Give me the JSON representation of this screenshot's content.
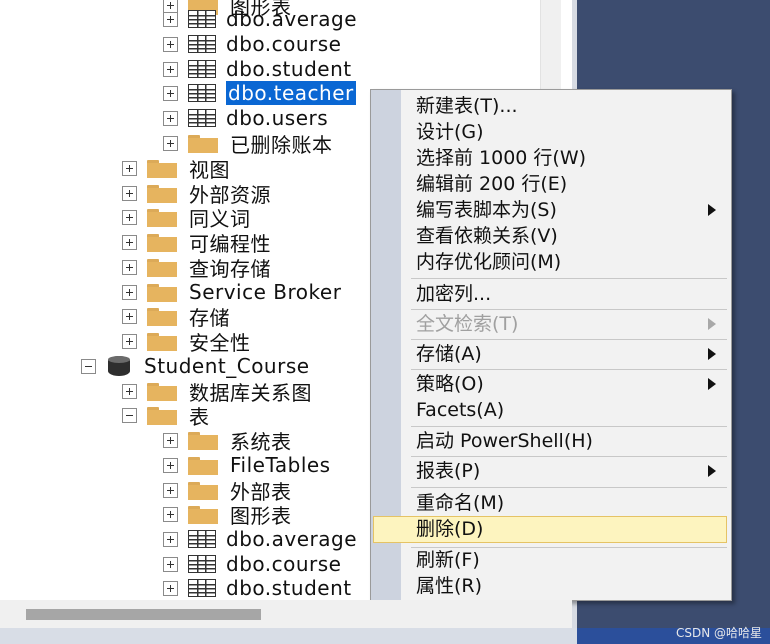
{
  "tree": {
    "nodes": [
      {
        "label": "图形表",
        "icon": "folder",
        "expander": "plus"
      },
      {
        "label": "dbo.average",
        "icon": "table",
        "expander": "plus"
      },
      {
        "label": "dbo.course",
        "icon": "table",
        "expander": "plus"
      },
      {
        "label": "dbo.student",
        "icon": "table",
        "expander": "plus"
      },
      {
        "label": "dbo.teacher",
        "icon": "table",
        "expander": "plus",
        "selected": true
      },
      {
        "label": "dbo.users",
        "icon": "table",
        "expander": "plus"
      },
      {
        "label": "已删除账本",
        "icon": "folder",
        "expander": "plus"
      },
      {
        "label": "视图",
        "icon": "folder",
        "expander": "plus"
      },
      {
        "label": "外部资源",
        "icon": "folder",
        "expander": "plus"
      },
      {
        "label": "同义词",
        "icon": "folder",
        "expander": "plus"
      },
      {
        "label": "可编程性",
        "icon": "folder",
        "expander": "plus"
      },
      {
        "label": "查询存储",
        "icon": "folder",
        "expander": "plus"
      },
      {
        "label": "Service Broker",
        "icon": "folder",
        "expander": "plus"
      },
      {
        "label": "存储",
        "icon": "folder",
        "expander": "plus"
      },
      {
        "label": "安全性",
        "icon": "folder",
        "expander": "plus"
      },
      {
        "label": "Student_Course",
        "icon": "database",
        "expander": "minus"
      },
      {
        "label": "数据库关系图",
        "icon": "folder",
        "expander": "plus"
      },
      {
        "label": "表",
        "icon": "folder",
        "expander": "minus"
      },
      {
        "label": "系统表",
        "icon": "folder",
        "expander": "plus"
      },
      {
        "label": "FileTables",
        "icon": "folder",
        "expander": "plus"
      },
      {
        "label": "外部表",
        "icon": "folder",
        "expander": "plus"
      },
      {
        "label": "图形表",
        "icon": "folder",
        "expander": "plus"
      },
      {
        "label": "dbo.average",
        "icon": "table",
        "expander": "plus"
      },
      {
        "label": "dbo.course",
        "icon": "table",
        "expander": "plus"
      },
      {
        "label": "dbo.student",
        "icon": "table",
        "expander": "plus"
      }
    ]
  },
  "context_menu": {
    "items": [
      {
        "label": "新建表(T)...",
        "submenu": false,
        "disabled": false
      },
      {
        "label": "设计(G)",
        "submenu": false,
        "disabled": false
      },
      {
        "label": "选择前 1000 行(W)",
        "submenu": false,
        "disabled": false
      },
      {
        "label": "编辑前 200 行(E)",
        "submenu": false,
        "disabled": false
      },
      {
        "label": "编写表脚本为(S)",
        "submenu": true,
        "disabled": false
      },
      {
        "label": "查看依赖关系(V)",
        "submenu": false,
        "disabled": false
      },
      {
        "label": "内存优化顾问(M)",
        "submenu": false,
        "disabled": false
      },
      {
        "label": "加密列...",
        "submenu": false,
        "disabled": false
      },
      {
        "label": "全文检索(T)",
        "submenu": true,
        "disabled": true
      },
      {
        "label": "存储(A)",
        "submenu": true,
        "disabled": false
      },
      {
        "label": "策略(O)",
        "submenu": true,
        "disabled": false
      },
      {
        "label": "Facets(A)",
        "submenu": false,
        "disabled": false
      },
      {
        "label": "启动 PowerShell(H)",
        "submenu": false,
        "disabled": false
      },
      {
        "label": "报表(P)",
        "submenu": true,
        "disabled": false
      },
      {
        "label": "重命名(M)",
        "submenu": false,
        "disabled": false
      },
      {
        "label": "删除(D)",
        "submenu": false,
        "disabled": false,
        "highlighted": true
      },
      {
        "label": "刷新(F)",
        "submenu": false,
        "disabled": false
      },
      {
        "label": "属性(R)",
        "submenu": false,
        "disabled": false
      }
    ]
  },
  "watermark": "CSDN @哈哈星",
  "colors": {
    "selection": "#0a67d3",
    "highlight": "#fdf4bf",
    "folder": "#e6b45f",
    "side_panel": "#3c4c6f"
  }
}
